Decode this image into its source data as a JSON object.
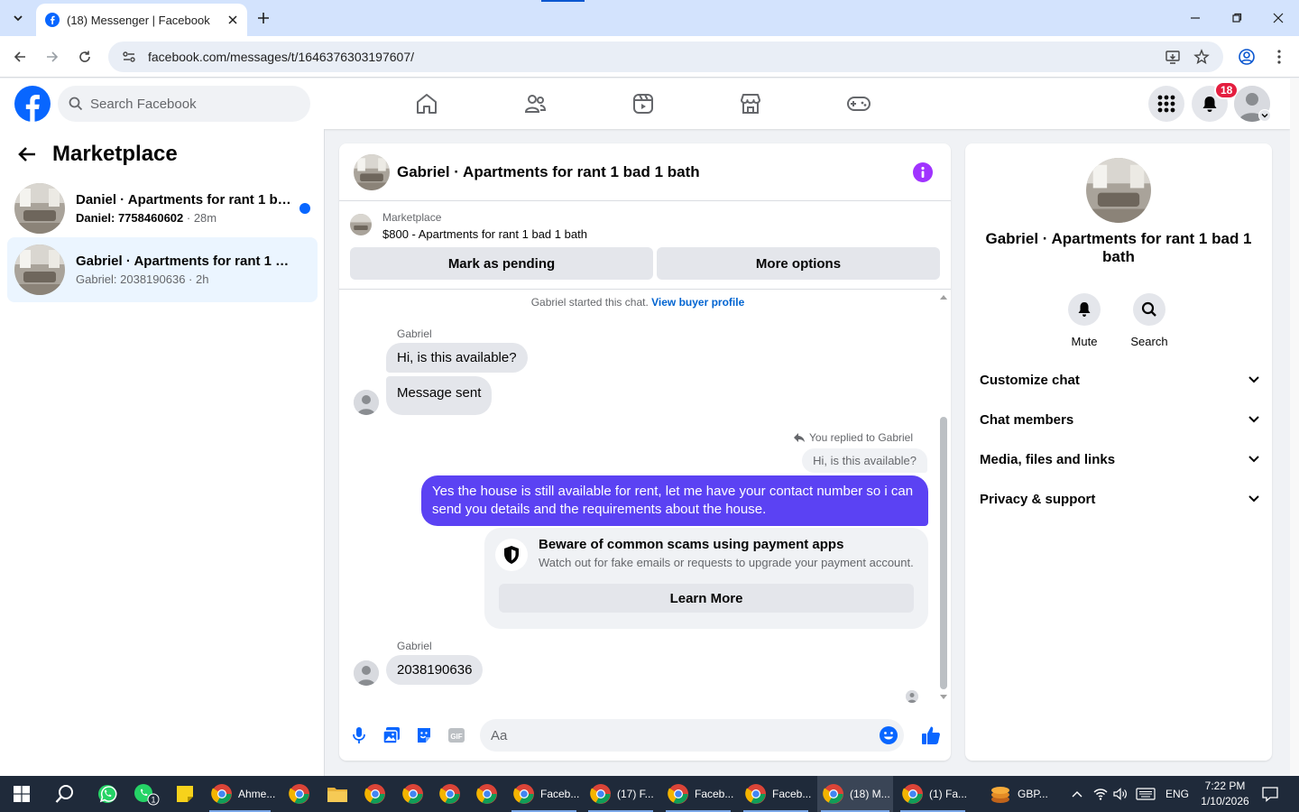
{
  "browser": {
    "tab_title": "(18) Messenger | Facebook",
    "url": "facebook.com/messages/t/1646376303197607/"
  },
  "fb": {
    "search_placeholder": "Search Facebook",
    "notification_count": "18",
    "brand_color": "#0866ff"
  },
  "left": {
    "title": "Marketplace",
    "conversations": [
      {
        "name": "Daniel · Apartments for rant 1 ba...",
        "sub": "Daniel: 7758460602",
        "time": "28m",
        "unread": true
      },
      {
        "name": "Gabriel · Apartments for rant 1 ba...",
        "sub": "Gabriel: 2038190636",
        "time": "2h",
        "unread": false
      }
    ]
  },
  "chat": {
    "title": "Gabriel · Apartments for rant 1 bad 1 bath",
    "marketplace_label": "Marketplace",
    "listing": "$800 - Apartments for rant 1 bad 1 bath",
    "mark_pending": "Mark as pending",
    "more_options": "More options",
    "started_text": "Gabriel started this chat.",
    "view_profile": "View buyer profile",
    "sender_name": "Gabriel",
    "msg1": "Hi, is this available?",
    "msg2": "Message sent",
    "replied_label": "You replied to Gabriel",
    "quoted": "Hi, is this available?",
    "my_reply": "Yes the house is still available for rent, let me have your contact number so i can send you details and the requirements about the house.",
    "scam_title": "Beware of common scams using payment apps",
    "scam_desc": "Watch out for fake emails or requests to upgrade your payment account.",
    "learn_more": "Learn More",
    "sender_name2": "Gabriel",
    "msg3": "2038190636",
    "input_placeholder": "Aa",
    "my_bubble_color": "#5b42f3"
  },
  "right": {
    "name": "Gabriel · Apartments for rant 1 bad 1 bath",
    "mute": "Mute",
    "search": "Search",
    "sections": [
      "Customize chat",
      "Chat members",
      "Media, files and links",
      "Privacy & support"
    ]
  },
  "taskbar": {
    "items": [
      "Ahme...",
      "Faceb...",
      "(17) F...",
      "Faceb...",
      "Faceb...",
      "(18) M...",
      "(1) Fa..."
    ],
    "gbp": "GBP...",
    "lang": "ENG",
    "time": "7:22 PM",
    "date": "1/10/2026",
    "wa_badge": "1"
  }
}
